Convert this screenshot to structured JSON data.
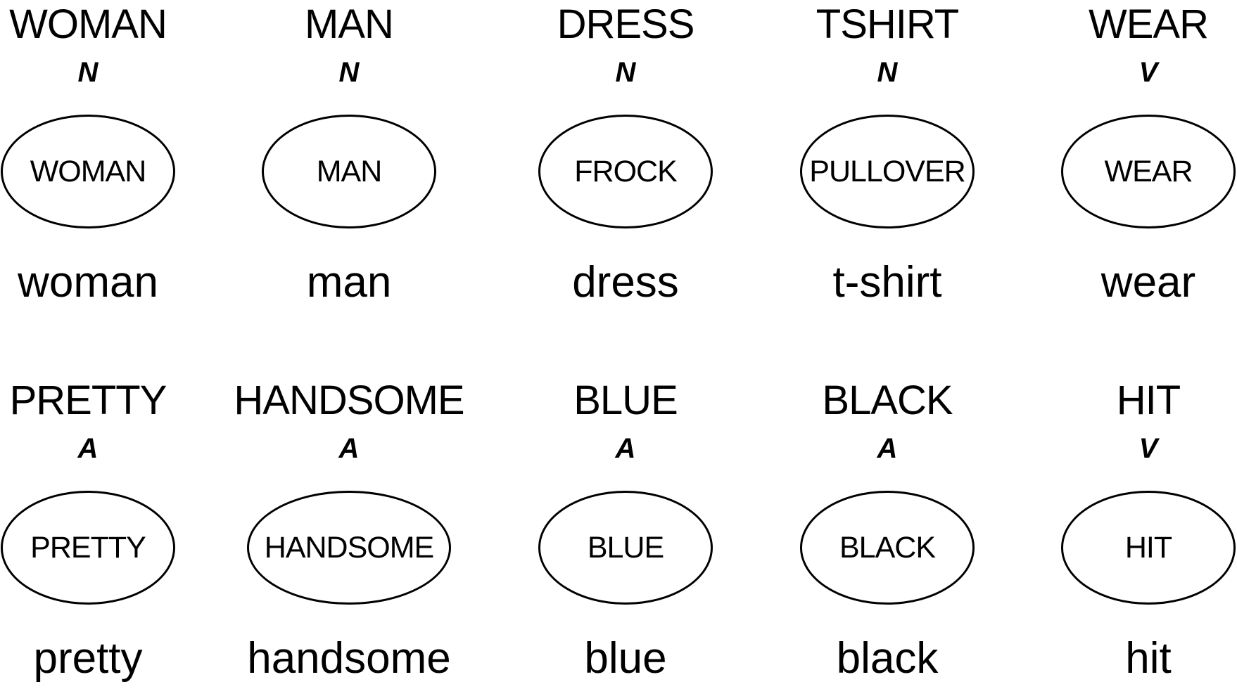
{
  "rows": [
    [
      {
        "concept": "WOMAN",
        "pos": "N",
        "lemma": "WOMAN",
        "word": "woman"
      },
      {
        "concept": "MAN",
        "pos": "N",
        "lemma": "MAN",
        "word": "man"
      },
      {
        "concept": "DRESS",
        "pos": "N",
        "lemma": "FROCK",
        "word": "dress"
      },
      {
        "concept": "TSHIRT",
        "pos": "N",
        "lemma": "PULLOVER",
        "word": "t-shirt"
      },
      {
        "concept": "WEAR",
        "pos": "V",
        "lemma": "WEAR",
        "word": "wear"
      }
    ],
    [
      {
        "concept": "PRETTY",
        "pos": "A",
        "lemma": "PRETTY",
        "word": "pretty"
      },
      {
        "concept": "HANDSOME",
        "pos": "A",
        "lemma": "HANDSOME",
        "word": "handsome"
      },
      {
        "concept": "BLUE",
        "pos": "A",
        "lemma": "BLUE",
        "word": "blue"
      },
      {
        "concept": "BLACK",
        "pos": "A",
        "lemma": "BLACK",
        "word": "black"
      },
      {
        "concept": "HIT",
        "pos": "V",
        "lemma": "HIT",
        "word": "hit"
      }
    ]
  ]
}
